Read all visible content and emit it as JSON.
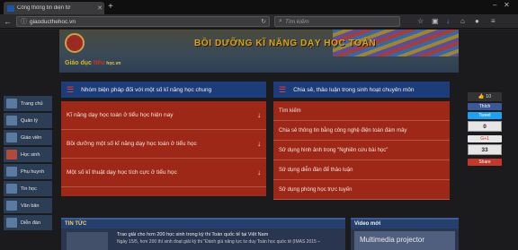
{
  "browser": {
    "tab_title": "Cổng thông tin điện tử",
    "url": "giaoducthehoc.vn",
    "search_placeholder": "Tìm kiếm"
  },
  "banner": {
    "title": "BỒI DƯỠNG KĨ NĂNG DẠY HỌC TOÁN",
    "sub_a": "Giáo dục",
    "sub_b": " tiểu ",
    "sub_c": "học.vn"
  },
  "sidebar": {
    "items": [
      {
        "label": "Trang chủ"
      },
      {
        "label": "Quản lý"
      },
      {
        "label": "Giáo viên"
      },
      {
        "label": "Học sinh"
      },
      {
        "label": "Phụ huynh"
      },
      {
        "label": "Tin học"
      },
      {
        "label": "Văn bản"
      },
      {
        "label": "Diễn đàn"
      }
    ]
  },
  "left_column": {
    "heading": "Nhóm biện pháp đối với một số kĩ năng học chung",
    "items": [
      {
        "label": "Kĩ năng dạy học toán ở tiểu học hiện nay"
      },
      {
        "label": "Bồi dưỡng một số kĩ năng dạy học toán ở tiểu học"
      },
      {
        "label": "Một số kĩ thuật dạy học tích cực ở tiểu học"
      }
    ]
  },
  "right_column": {
    "heading": "Chia sẻ, thảo luận trong sinh hoạt chuyên môn",
    "items": [
      {
        "label": "Tìm kiếm"
      },
      {
        "label": "Chia sẻ thông tin bằng công nghệ điện toán đám mây"
      },
      {
        "label": "Sử dụng hình ảnh trong \"Nghiên cứu bài học\""
      },
      {
        "label": "Sử dụng diễn đàn để thảo luận"
      },
      {
        "label": "Sử dụng phòng học trực tuyến"
      }
    ]
  },
  "share": {
    "like": "Thích",
    "tweet": "Tweet",
    "like_count_label": "10",
    "tweet_count": "0",
    "gplus": "G+1",
    "gplus_count": "33",
    "share": "Share"
  },
  "news": {
    "heading": "TIN TỨC",
    "item_title": "Trao giải cho hơn 200 học sinh trong kỳ thi Toán quốc tế tại Việt Nam",
    "item_desc": "Ngày 15/5, hơn 200 thí sinh đoạt giải kỳ thi \"Đánh giá năng lực tư duy Toán học quốc tế (IMAS 2015 –"
  },
  "video": {
    "heading": "Video mới",
    "title": "Multimedia projector"
  },
  "colors": {
    "panel_red": "#9e2818",
    "header_blue": "#1d3c7a",
    "title_gold": "#d6a41d"
  }
}
